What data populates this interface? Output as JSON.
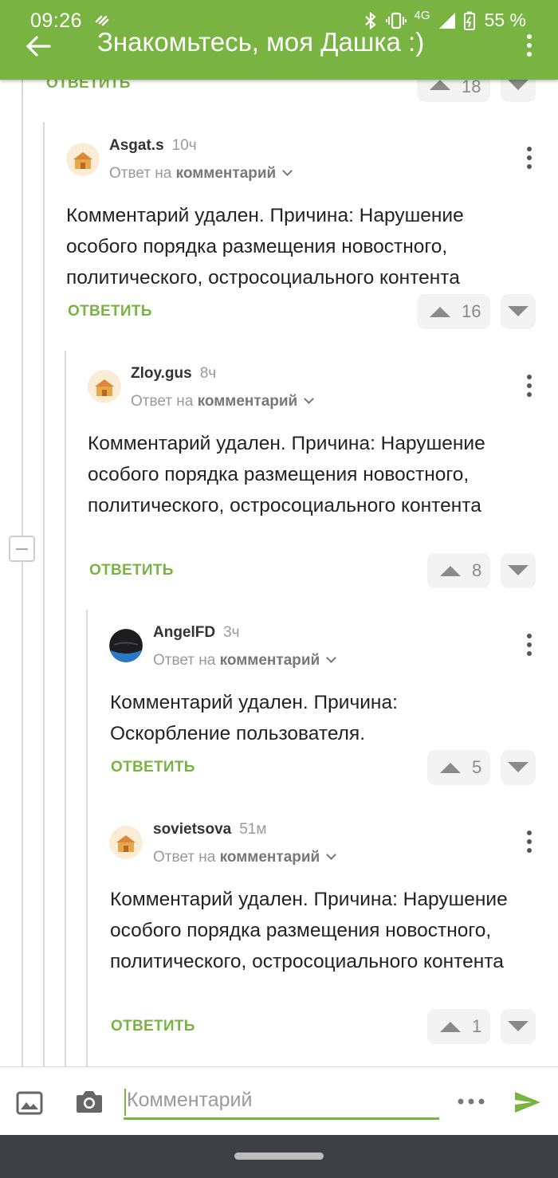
{
  "status_bar": {
    "time": "09:26",
    "network": "4G",
    "battery": "55 %"
  },
  "header": {
    "title": "Знакомьтесь, моя Дашка :)"
  },
  "top_partial": {
    "reply_label": "ОТВЕТИТЬ",
    "score": "18"
  },
  "comments": [
    {
      "author": "Asgat.s",
      "time": "10ч",
      "reply_prefix": "Ответ на",
      "reply_target": "комментарий",
      "text": "Комментарий удален. Причина: Нарушение особого порядка размещения новостного, политического, остросоциального контента",
      "reply_label": "ОТВЕТИТЬ",
      "score": "16"
    },
    {
      "author": "Zloy.gus",
      "time": "8ч",
      "reply_prefix": "Ответ на",
      "reply_target": "комментарий",
      "text": "Комментарий удален. Причина: Нарушение особого порядка размещения новостного, политического, остросоциального контента",
      "reply_label": "ОТВЕТИТЬ",
      "score": "8"
    },
    {
      "author": "AngelFD",
      "time": "3ч",
      "reply_prefix": "Ответ на",
      "reply_target": "комментарий",
      "text": "Комментарий удален. Причина: Оскорбление пользователя.",
      "reply_label": "ОТВЕТИТЬ",
      "score": "5"
    },
    {
      "author": "sovietsova",
      "time": "51м",
      "reply_prefix": "Ответ на",
      "reply_target": "комментарий",
      "text": "Комментарий удален. Причина: Нарушение особого порядка размещения новостного, политического, остросоциального контента",
      "reply_label": "ОТВЕТИТЬ",
      "score": "1"
    }
  ],
  "composer": {
    "placeholder": "Комментарий"
  },
  "colors": {
    "accent": "#79b443",
    "navbar": "#3f4044"
  },
  "icons": [
    "back-arrow-icon",
    "overflow-menu-icon",
    "image-icon",
    "camera-icon",
    "more-icon",
    "send-icon"
  ]
}
